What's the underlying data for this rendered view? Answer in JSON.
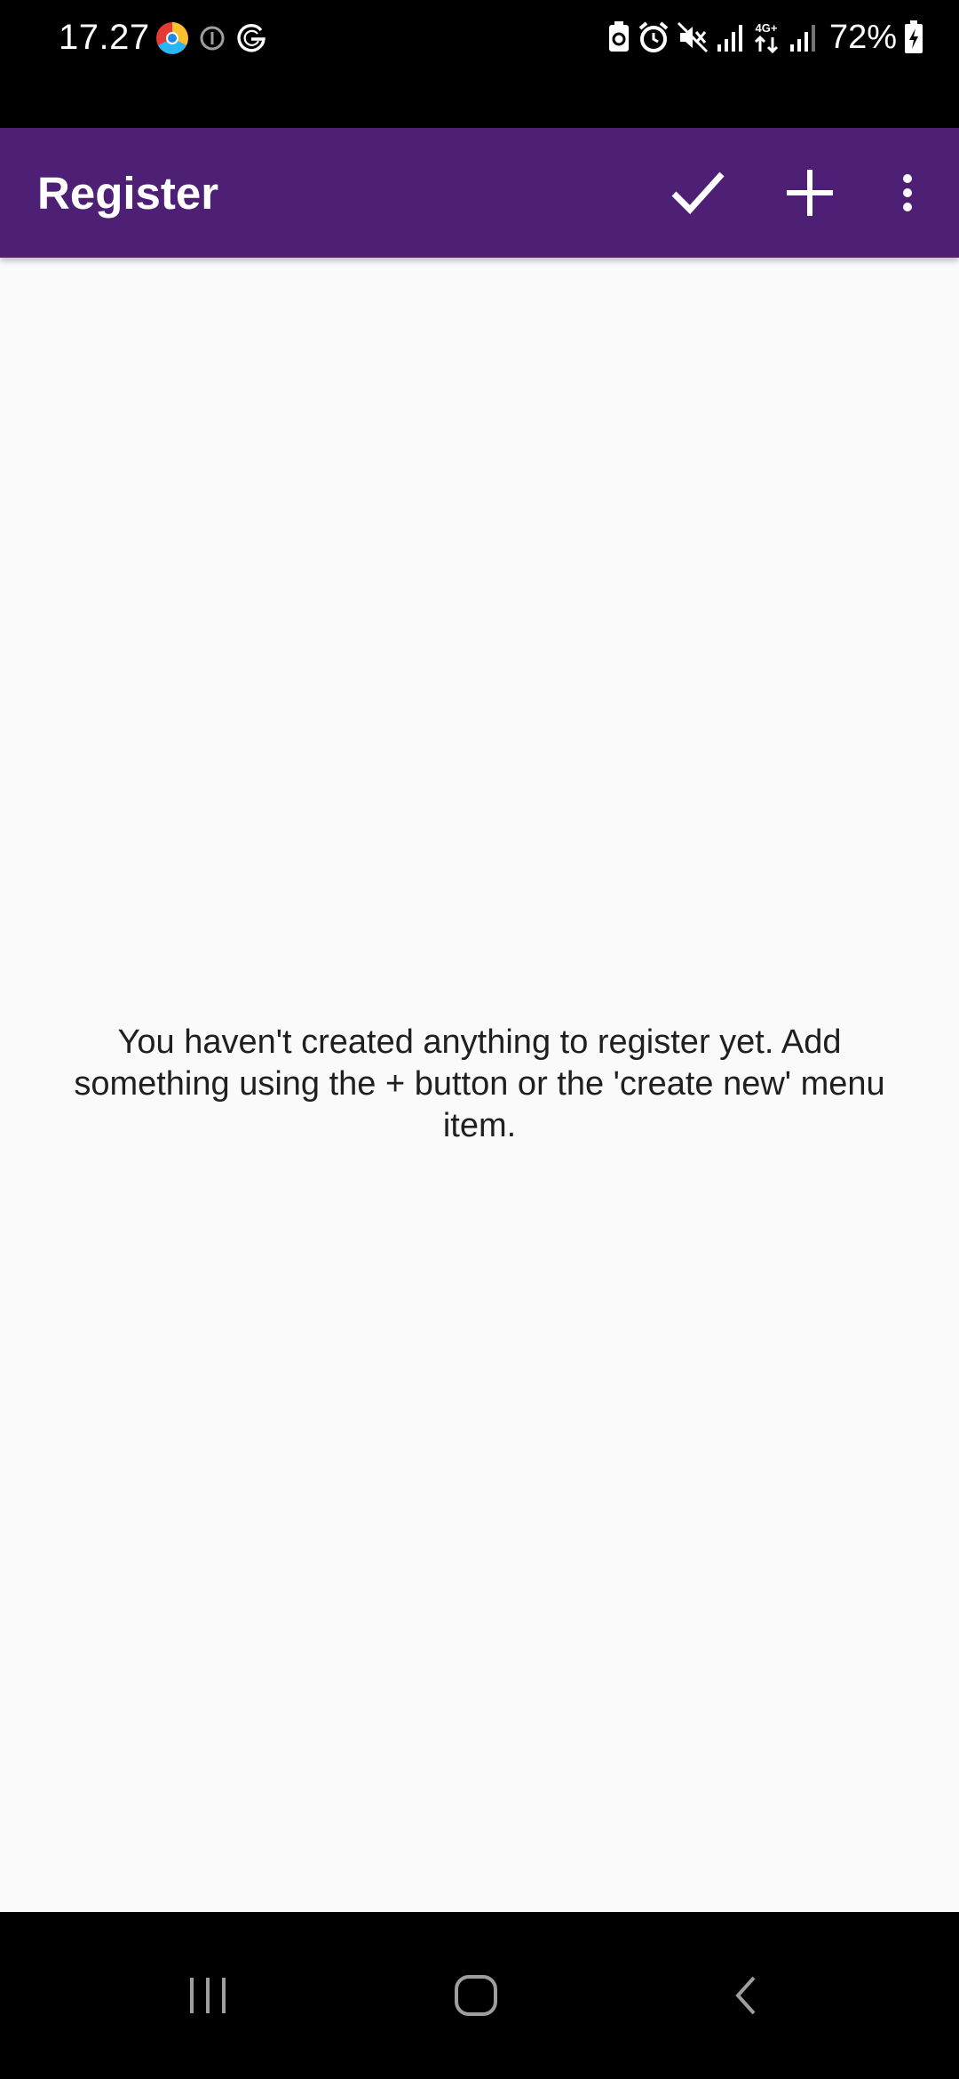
{
  "status_bar": {
    "time": "17.27",
    "battery": "72%",
    "left_icons": [
      "chrome-like-app-icon",
      "info-circle-icon",
      "g-logo-icon"
    ],
    "right_icons": [
      "battery-saver-icon",
      "alarm-icon",
      "mute-icon",
      "signal-icon",
      "4g-icon",
      "signal-icon",
      "battery-icon"
    ]
  },
  "app_bar": {
    "title": "Register",
    "actions": [
      "check-icon",
      "add-icon",
      "more-vert-icon"
    ],
    "color": "#4e2075"
  },
  "content": {
    "empty_message": "You haven't created anything to register yet. Add something using the + button or the 'create new' menu item."
  },
  "nav_bar": {
    "buttons": [
      "recents-icon",
      "home-icon",
      "back-icon"
    ]
  }
}
